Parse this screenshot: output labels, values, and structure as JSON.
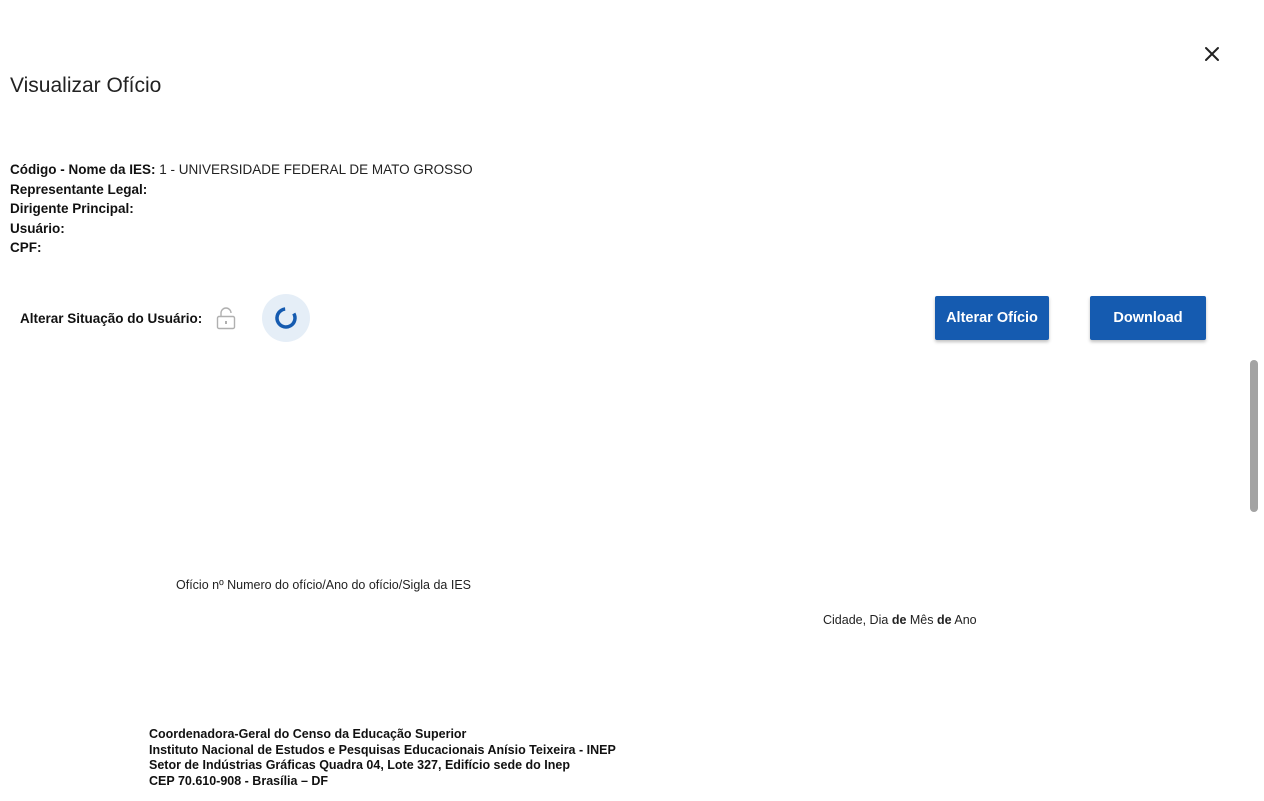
{
  "dialog": {
    "title": "Visualizar Ofício",
    "close_icon": "close-icon"
  },
  "info": {
    "codigo_label": "Código - Nome da IES:",
    "codigo_value": "1 - UNIVERSIDADE FEDERAL DE MATO GROSSO",
    "representante_label": "Representante Legal:",
    "dirigente_label": "Dirigente Principal:",
    "usuario_label": "Usuário:",
    "cpf_label": "CPF:"
  },
  "status": {
    "label": "Alterar Situação do Usuário:",
    "lock_icon": "unlock-icon",
    "spinner_icon": "loading-spinner-icon"
  },
  "actions": {
    "alterar_label": "Alterar Ofício",
    "download_label": "Download"
  },
  "document": {
    "oficio_num": "Ofício nº Numero do ofício/Ano do ofício/Sigla da IES",
    "cidade": "Cidade, Dia",
    "de1": "de",
    "mes": "Mês",
    "de2": "de",
    "ano": "Ano",
    "address_lines": [
      "Coordenadora-Geral do Censo da Educação Superior",
      "Instituto Nacional de Estudos e Pesquisas Educacionais Anísio Teixeira - INEP",
      "Setor de Indústrias Gráficas Quadra 04, Lote 327, Edifício sede do Inep",
      "CEP 70.610-908 - Brasília – DF"
    ]
  },
  "colors": {
    "primary_button": "#155bb0",
    "spinner": "#155bb0",
    "spinner_bg": "#e5eef7",
    "scrollbar": "#a3a3a3"
  }
}
